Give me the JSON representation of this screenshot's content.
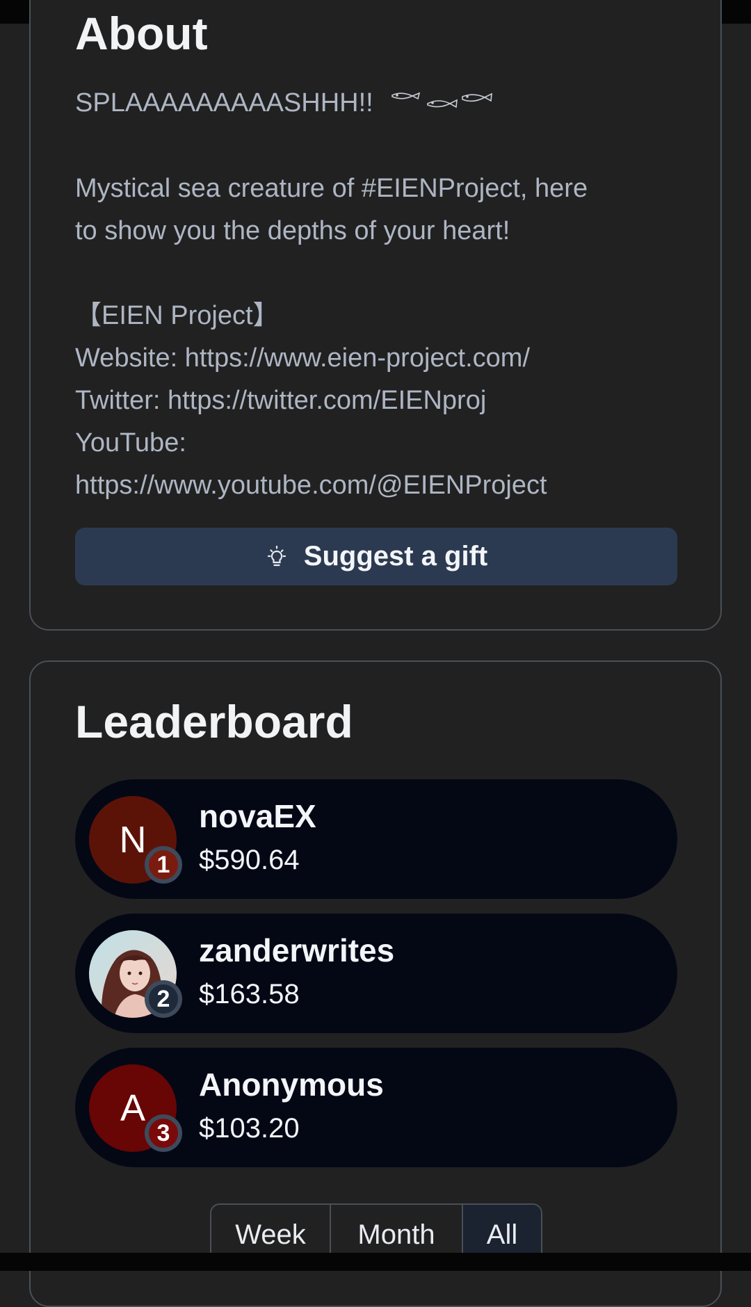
{
  "about": {
    "title": "About",
    "tagline": "SPLAAAAAAAAASHHH!!",
    "description_1": "Mystical sea creature of #EIENProject, here",
    "description_2": "to show you the depths of your heart!",
    "project_heading": "【EIEN Project】",
    "website": "Website: https://www.eien-project.com/",
    "twitter": "Twitter: https://twitter.com/EIENproj",
    "youtube_label": "YouTube:",
    "youtube_url": "https://www.youtube.com/@EIENProject",
    "suggest_button": "Suggest a gift",
    "suggest_icon": "lightbulb-icon",
    "decor_icon": "fish-doodle-icon"
  },
  "leaderboard": {
    "title": "Leaderboard",
    "entries": [
      {
        "rank": "1",
        "initial": "N",
        "name": "novaEX",
        "amount": "$590.64",
        "avatar_color": "#5c1307",
        "badge_color": "#7a1b10"
      },
      {
        "rank": "2",
        "initial": "",
        "name": "zanderwrites",
        "amount": "$163.58",
        "avatar_color": "#c9a58f",
        "badge_color": "#1e2a3a"
      },
      {
        "rank": "3",
        "initial": "A",
        "name": "Anonymous",
        "amount": "$103.20",
        "avatar_color": "#680505",
        "badge_color": "#7a0a0a"
      }
    ],
    "periods": [
      "Week",
      "Month",
      "All"
    ],
    "active_period": "All"
  }
}
